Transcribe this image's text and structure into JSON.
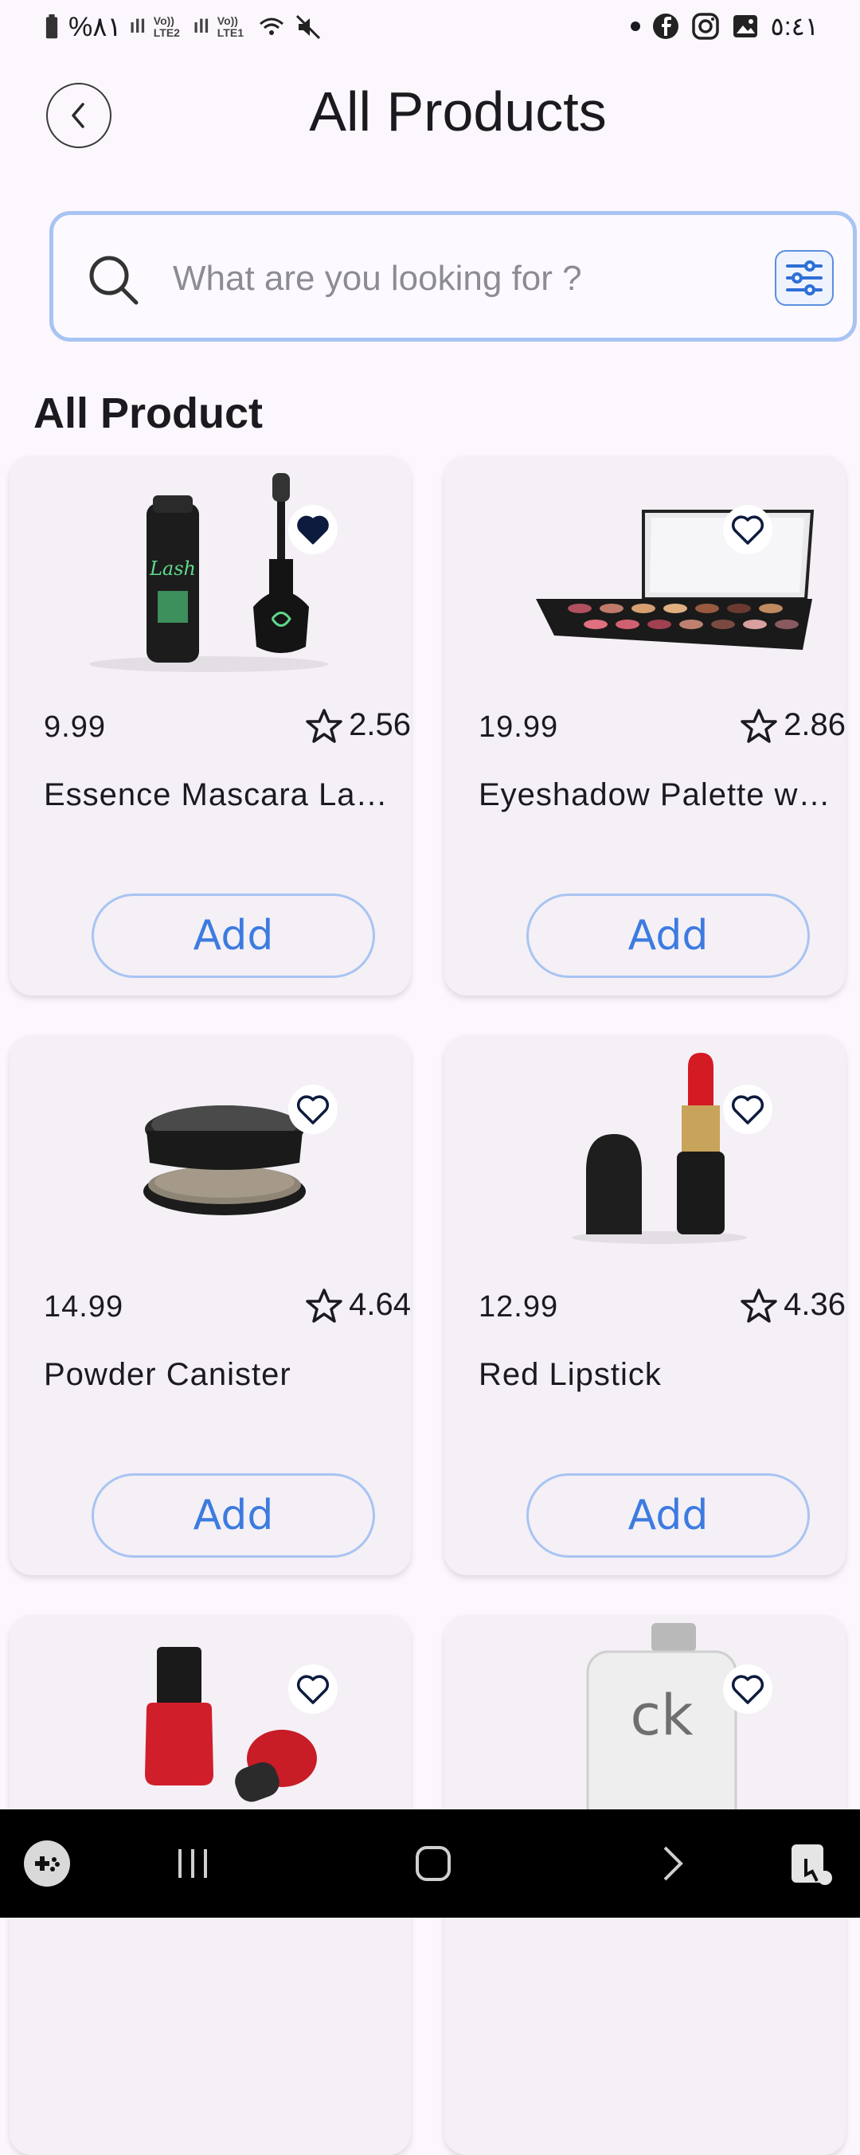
{
  "status_bar": {
    "battery_percent": "%٨١",
    "sim1_label": "Vo)) LTE2",
    "sim2_label": "Vo)) LTE1",
    "time": "٥:٤١"
  },
  "header": {
    "title": "All Products"
  },
  "search": {
    "placeholder": "What are you looking for ?",
    "value": ""
  },
  "section_title": "All Product",
  "products": [
    {
      "price": "9.99",
      "rating": "2.56",
      "name": "Essence Mascara Lash Princess",
      "favorited": true,
      "add_label": "Add"
    },
    {
      "price": "19.99",
      "rating": "2.86",
      "name": "Eyeshadow Palette with Mirror",
      "favorited": false,
      "add_label": "Add"
    },
    {
      "price": "14.99",
      "rating": "4.64",
      "name": "Powder Canister",
      "favorited": false,
      "add_label": "Add"
    },
    {
      "price": "12.99",
      "rating": "4.36",
      "name": "Red Lipstick",
      "favorited": false,
      "add_label": "Add"
    },
    {
      "price": "",
      "rating": "",
      "name": "",
      "favorited": false,
      "add_label": ""
    },
    {
      "price": "",
      "rating": "",
      "name": "",
      "favorited": false,
      "add_label": ""
    }
  ],
  "icons": {
    "back": "chevron-left-icon",
    "search": "search-icon",
    "filter": "sliders-icon",
    "favorite": "heart-icon",
    "rating": "star-icon"
  },
  "colors": {
    "accent": "#3d7be0",
    "border": "#a8c4f2",
    "background": "#fcf7fd",
    "card": "#f4f0f6",
    "heart_filled": "#0d1b3e"
  }
}
